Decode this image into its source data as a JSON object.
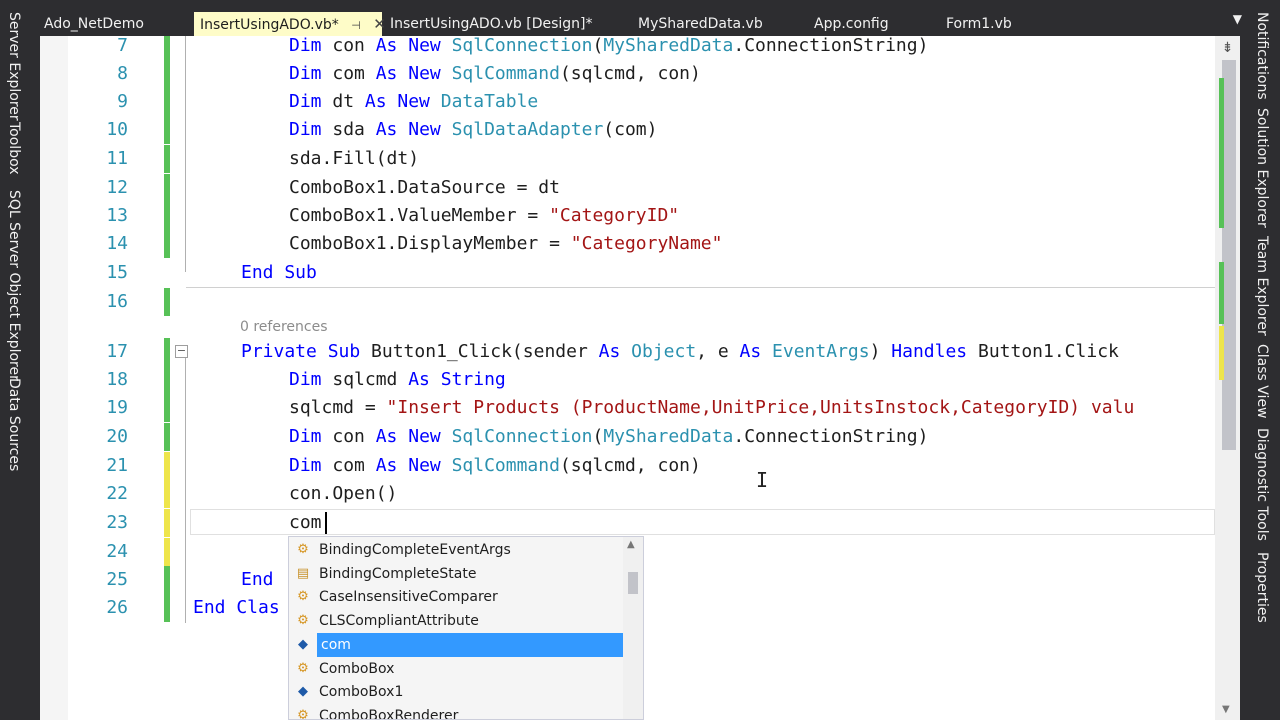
{
  "tabs": [
    {
      "label": "Ado_NetDemo",
      "active": false
    },
    {
      "label": "InsertUsingADO.vb*",
      "active": true,
      "pin_icon": "pin-icon",
      "close_icon": "close-icon"
    },
    {
      "label": "InsertUsingADO.vb [Design]*",
      "active": false
    },
    {
      "label": "MySharedData.vb",
      "active": false
    },
    {
      "label": "App.config",
      "active": false
    },
    {
      "label": "Form1.vb",
      "active": false
    }
  ],
  "tab_menu": "▼",
  "left_panels": [
    "Server Explorer",
    "Toolbox",
    "SQL Server Object Explorer",
    "Data Sources"
  ],
  "right_panels": [
    "Notifications",
    "Solution Explorer",
    "Team Explorer",
    "Class View",
    "Diagnostic Tools",
    "Properties"
  ],
  "codelens": "0 references",
  "colors": {
    "keyword": "#0000ff",
    "type": "#2b91af",
    "string": "#a31515",
    "changed_saved": "#57c157",
    "changed_unsaved": "#eee54b",
    "selection": "#3399ff"
  },
  "code_lines": [
    {
      "num": "7",
      "change": "green",
      "indent": 1,
      "tokens": [
        [
          "kw",
          "Dim "
        ],
        [
          "",
          "con "
        ],
        [
          "kw",
          "As New "
        ],
        [
          "ty",
          "SqlConnection"
        ],
        [
          "",
          "("
        ],
        [
          "ty",
          "MySharedData"
        ],
        [
          "",
          ".ConnectionString)"
        ]
      ]
    },
    {
      "num": "8",
      "change": "green",
      "indent": 1,
      "tokens": [
        [
          "kw",
          "Dim "
        ],
        [
          "",
          "com "
        ],
        [
          "kw",
          "As New "
        ],
        [
          "ty",
          "SqlCommand"
        ],
        [
          "",
          "(sqlcmd, con)"
        ]
      ]
    },
    {
      "num": "9",
      "change": "green",
      "indent": 1,
      "tokens": [
        [
          "kw",
          "Dim "
        ],
        [
          "",
          "dt "
        ],
        [
          "kw",
          "As New "
        ],
        [
          "ty",
          "DataTable"
        ]
      ]
    },
    {
      "num": "10",
      "change": "green",
      "indent": 1,
      "tokens": [
        [
          "kw",
          "Dim "
        ],
        [
          "",
          "sda "
        ],
        [
          "kw",
          "As New "
        ],
        [
          "ty",
          "SqlDataAdapter"
        ],
        [
          "",
          "(com)"
        ]
      ]
    },
    {
      "num": "11",
      "change": "green",
      "indent": 1,
      "tokens": [
        [
          "",
          "sda.Fill(dt)"
        ]
      ]
    },
    {
      "num": "12",
      "change": "green",
      "indent": 1,
      "tokens": [
        [
          "",
          "ComboBox1.DataSource = dt"
        ]
      ]
    },
    {
      "num": "13",
      "change": "green",
      "indent": 1,
      "tokens": [
        [
          "",
          "ComboBox1.ValueMember = "
        ],
        [
          "st",
          "\"CategoryID\""
        ]
      ]
    },
    {
      "num": "14",
      "change": "green",
      "indent": 1,
      "tokens": [
        [
          "",
          "ComboBox1.DisplayMember = "
        ],
        [
          "st",
          "\"CategoryName\""
        ]
      ]
    },
    {
      "num": "15",
      "change": "",
      "indent": 0,
      "tokens": [
        [
          "kw",
          "End Sub"
        ]
      ]
    },
    {
      "num": "16",
      "change": "green",
      "indent": 0,
      "tokens": []
    },
    {
      "num": "17",
      "change": "green",
      "indent": 0,
      "tokens": [
        [
          "kw",
          "Private Sub "
        ],
        [
          "",
          "Button1_Click(sender "
        ],
        [
          "kw",
          "As "
        ],
        [
          "ty",
          "Object"
        ],
        [
          "",
          ", e "
        ],
        [
          "kw",
          "As "
        ],
        [
          "ty",
          "EventArgs"
        ],
        [
          "",
          ") "
        ],
        [
          "kw",
          "Handles "
        ],
        [
          "",
          "Button1.Click"
        ]
      ]
    },
    {
      "num": "18",
      "change": "green",
      "indent": 1,
      "tokens": [
        [
          "kw",
          "Dim "
        ],
        [
          "",
          "sqlcmd "
        ],
        [
          "kw",
          "As String"
        ]
      ]
    },
    {
      "num": "19",
      "change": "green",
      "indent": 1,
      "tokens": [
        [
          "",
          "sqlcmd = "
        ],
        [
          "st",
          "\"Insert Products (ProductName,UnitPrice,UnitsInstock,CategoryID) valu"
        ]
      ]
    },
    {
      "num": "20",
      "change": "green",
      "indent": 1,
      "tokens": [
        [
          "kw",
          "Dim "
        ],
        [
          "",
          "con "
        ],
        [
          "kw",
          "As New "
        ],
        [
          "ty",
          "SqlConnection"
        ],
        [
          "",
          "("
        ],
        [
          "ty",
          "MySharedData"
        ],
        [
          "",
          ".ConnectionString)"
        ]
      ]
    },
    {
      "num": "21",
      "change": "yellow",
      "indent": 1,
      "tokens": [
        [
          "kw",
          "Dim "
        ],
        [
          "",
          "com "
        ],
        [
          "kw",
          "As New "
        ],
        [
          "ty",
          "SqlCommand"
        ],
        [
          "",
          "(sqlcmd, con)"
        ]
      ]
    },
    {
      "num": "22",
      "change": "yellow",
      "indent": 1,
      "tokens": [
        [
          "",
          "con.Open()"
        ]
      ]
    },
    {
      "num": "23",
      "change": "yellow",
      "indent": 1,
      "tokens": [
        [
          "",
          "com"
        ]
      ]
    },
    {
      "num": "24",
      "change": "yellow",
      "indent": 0,
      "tokens": []
    },
    {
      "num": "25",
      "change": "green",
      "indent": 0,
      "tokens": [
        [
          "kw",
          "End"
        ]
      ]
    },
    {
      "num": "26",
      "change": "green",
      "indent": -1,
      "tokens": [
        [
          "kw",
          "End Clas"
        ]
      ]
    }
  ],
  "autocomplete": {
    "items": [
      {
        "label": "BindingCompleteEventArgs",
        "icon": "class-icon",
        "selected": false
      },
      {
        "label": "BindingCompleteState",
        "icon": "enum-icon",
        "selected": false
      },
      {
        "label": "CaseInsensitiveComparer",
        "icon": "class-icon",
        "selected": false
      },
      {
        "label": "CLSCompliantAttribute",
        "icon": "class-icon",
        "selected": false
      },
      {
        "label": "com",
        "icon": "local-variable-icon",
        "selected": true
      },
      {
        "label": "ComboBox",
        "icon": "class-icon",
        "selected": false
      },
      {
        "label": "ComboBox1",
        "icon": "field-icon",
        "selected": false
      },
      {
        "label": "ComboBoxRenderer",
        "icon": "class-icon",
        "selected": false
      }
    ]
  }
}
